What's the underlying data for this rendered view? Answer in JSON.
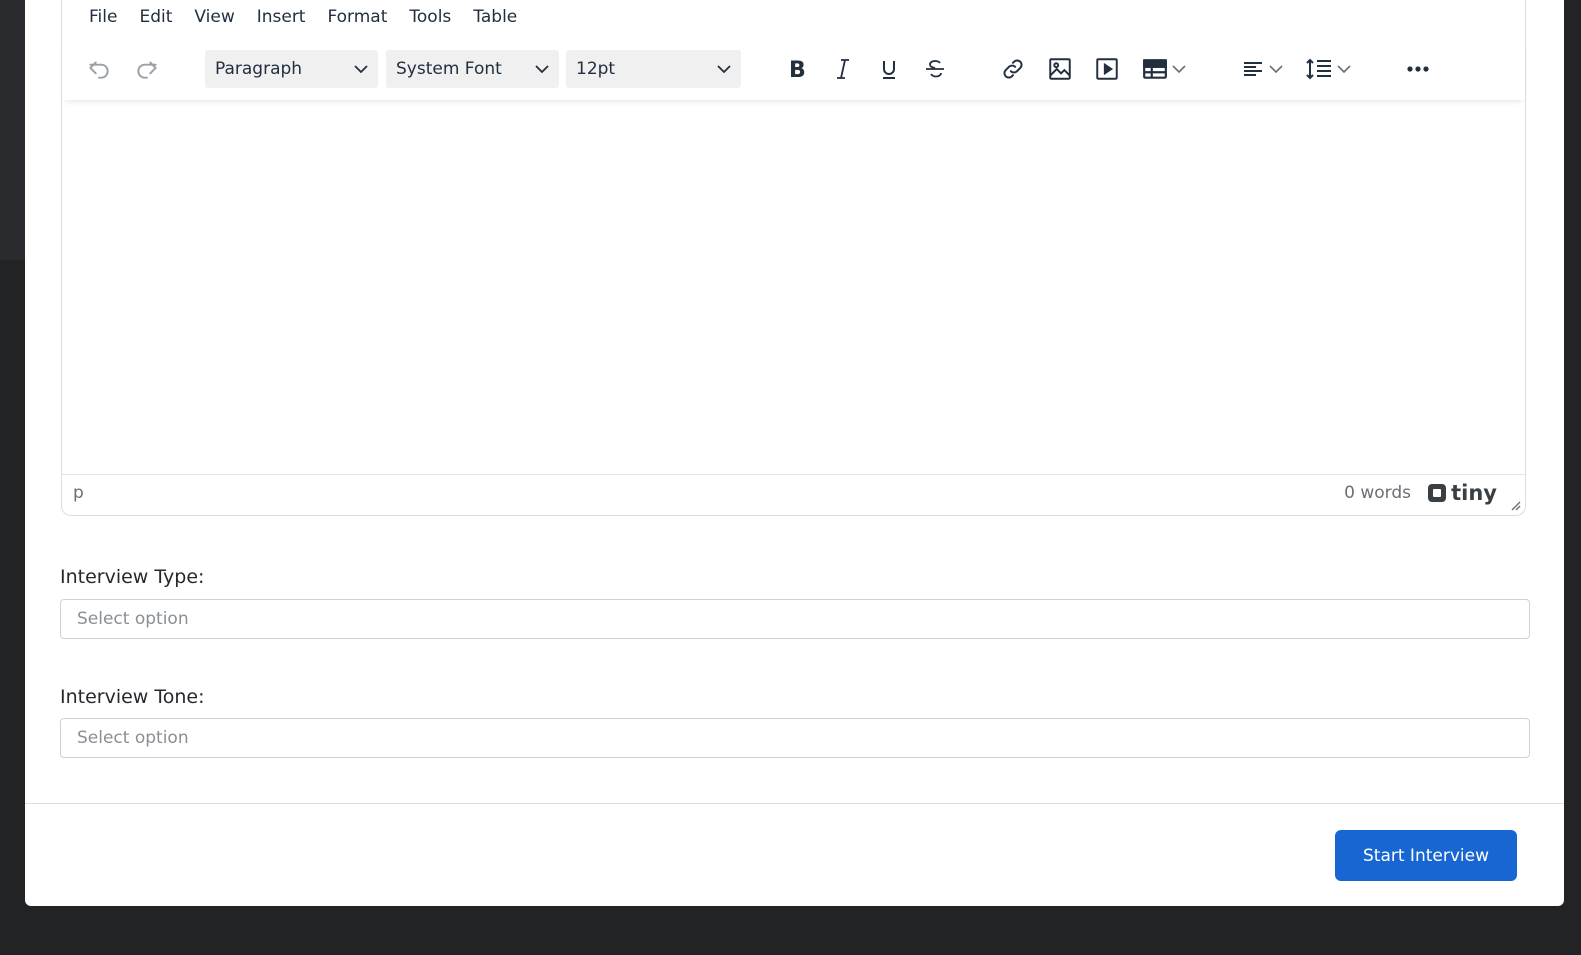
{
  "editor": {
    "menu": [
      "File",
      "Edit",
      "View",
      "Insert",
      "Format",
      "Tools",
      "Table"
    ],
    "toolbar": {
      "block_format": "Paragraph",
      "font_family": "System Font",
      "font_size": "12pt",
      "icons": [
        "undo-icon",
        "redo-icon",
        "bold-icon",
        "italic-icon",
        "underline-icon",
        "strikethrough-icon",
        "link-icon",
        "image-icon",
        "media-icon",
        "table-icon",
        "align-left-icon",
        "line-height-icon",
        "more-icon"
      ]
    },
    "status": {
      "path": "p",
      "word_count": "0 words",
      "brand": "tiny"
    }
  },
  "form": {
    "interview_type": {
      "label": "Interview Type:",
      "placeholder": "Select option"
    },
    "interview_tone": {
      "label": "Interview Tone:",
      "placeholder": "Select option"
    }
  },
  "footer": {
    "primary_label": "Start Interview"
  },
  "colors": {
    "primary": "#1766d2",
    "backdrop": "#222325",
    "toolbar_select_bg": "#f0f0f0"
  }
}
